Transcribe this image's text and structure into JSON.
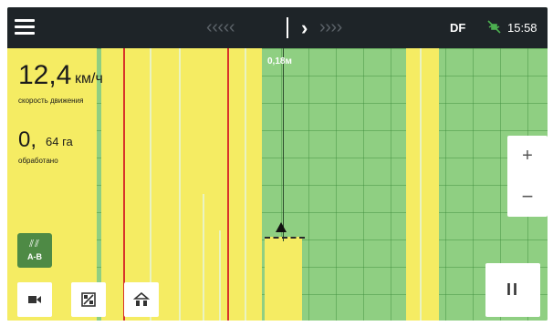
{
  "topbar": {
    "menu_icon": "hamburger-menu-icon",
    "left_chevrons": "‹ ‹ ‹ ‹ ‹",
    "center_chevron": "›",
    "right_chevrons": "› › › ›",
    "status_code": "DF",
    "satellite_icon": "satellite-signal-icon",
    "time": "15:58"
  },
  "guidance": {
    "offset": "0,18м"
  },
  "stats": {
    "speed_value": "12,4",
    "speed_unit": "км/ч",
    "speed_label": "скорость движения",
    "area_value": "0,",
    "area_unit": "64 га",
    "area_label": "обработано"
  },
  "controls": {
    "ab_icon": "guidance-lines-icon",
    "ab_label": "A-B",
    "camera_icon": "video-camera-icon",
    "section_icon": "section-control-icon",
    "implement_icon": "implement-icon",
    "zoom_in": "+",
    "zoom_out": "−",
    "pause": "II"
  },
  "colors": {
    "field_green": "#8fcf82",
    "coverage_yellow": "#f5ec63",
    "boundary_red": "#d8342a",
    "topbar": "#1e2428",
    "ab_button": "#4e8a45"
  }
}
